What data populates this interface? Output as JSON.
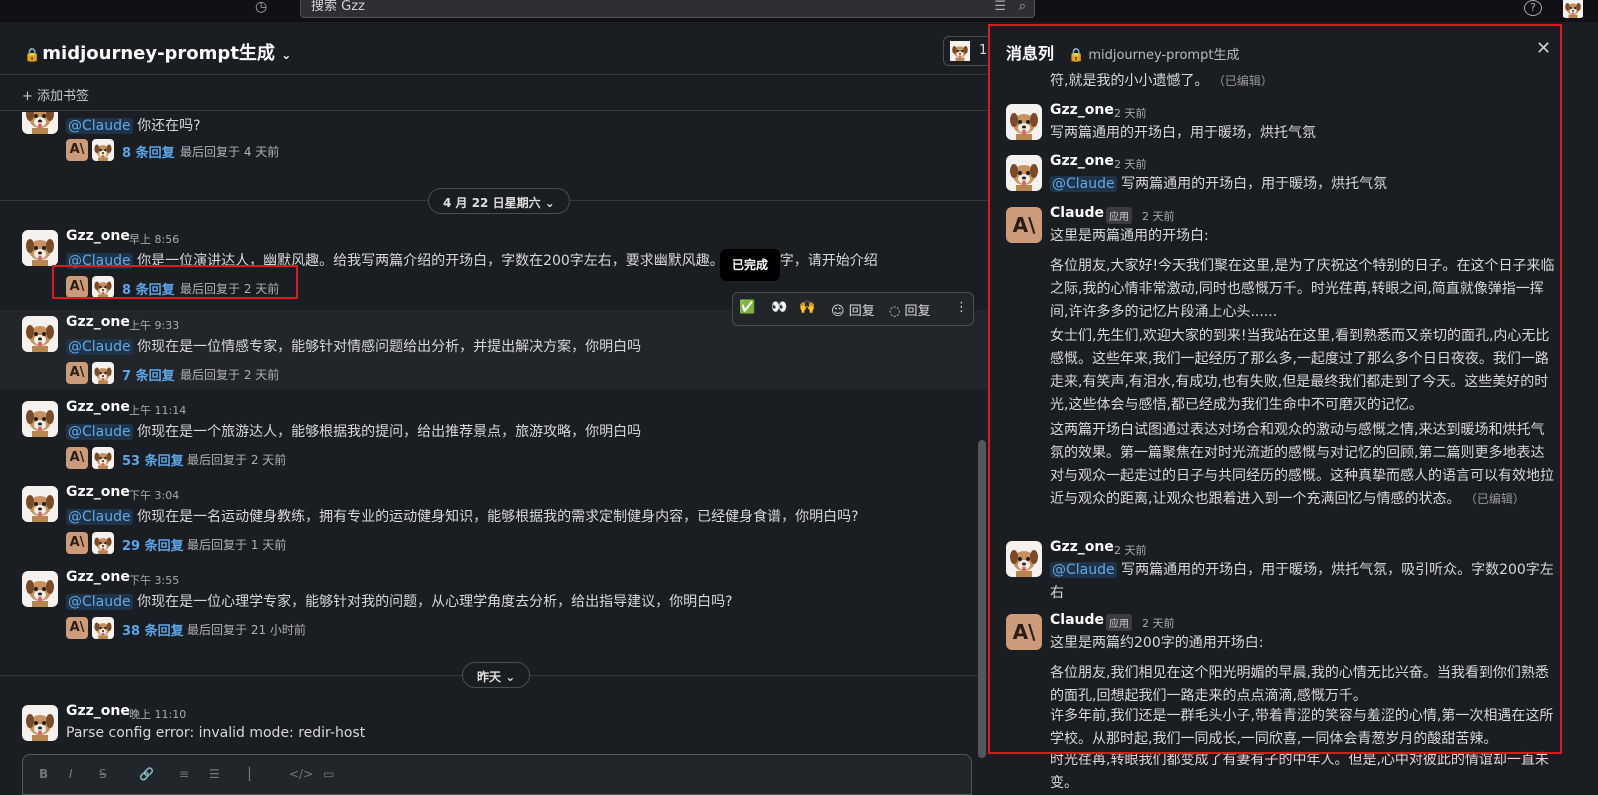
{
  "topbar": {
    "search_placeholder": "搜索 Gzz"
  },
  "channel": {
    "name": "midjourney-prompt生成",
    "member_count": "1",
    "add_bookmark": "添加书签"
  },
  "messages_top": {
    "text": "你还在吗?",
    "mention": "@Claude",
    "reply_count": "8 条回复",
    "last_reply": "最后回复于 4 天前"
  },
  "date_pill_1": "4 月 22 日星期六",
  "date_pill_2": "昨天",
  "messages": [
    {
      "name": "Gzz_one",
      "time": "早上 8:56",
      "mention": "@Claude",
      "text": "你是一位演讲达人，幽默风趣。给我写两篇介绍的开场白，字数在200字左右，要求幽默风趣。是你的名字，请开始介绍",
      "reply_count": "8 条回复",
      "last_reply": "最后回复于 2 天前"
    },
    {
      "name": "Gzz_one",
      "time": "上午 9:33",
      "mention": "@Claude",
      "text": "你现在是一位情感专家，能够针对情感问题给出分析，并提出解决方案，你明白吗",
      "reply_count": "7 条回复",
      "last_reply": "最后回复于 2 天前"
    },
    {
      "name": "Gzz_one",
      "time": "上午 11:14",
      "mention": "@Claude",
      "text": "你现在是一个旅游达人，能够根据我的提问，给出推荐景点，旅游攻略，你明白吗",
      "reply_count": "53 条回复",
      "last_reply": "最后回复于 2 天前"
    },
    {
      "name": "Gzz_one",
      "time": "下午 3:04",
      "mention": "@Claude",
      "text": "你现在是一名运动健身教练，拥有专业的运动健身知识，能够根据我的需求定制健身内容，已经健身食谱，你明白吗?",
      "reply_count": "29 条回复",
      "last_reply": "最后回复于 1 天前"
    },
    {
      "name": "Gzz_one",
      "time": "下午 3:55",
      "mention": "@Claude",
      "text": "你现在是一位心理学专家，能够针对我的问题，从心理学角度去分析，给出指导建议，你明白吗?",
      "reply_count": "38 条回复",
      "last_reply": "最后回复于 21 小时前"
    }
  ],
  "last_message": {
    "name": "Gzz_one",
    "time": "晚上 11:10",
    "text": "Parse config error: invalid mode: redir-host"
  },
  "toolbar": {
    "tooltip": "已完成",
    "check": "✅",
    "eyes": "👀",
    "hands": "🙌",
    "reply_emoji": "回复",
    "reply": "回复"
  },
  "thread": {
    "title": "消息列",
    "channel": "midjourney-prompt生成",
    "top_fragment": "符,就是我的小小遗憾了。",
    "edited": "（已编辑）",
    "app_tag": "应用",
    "m1": {
      "name": "Gzz_one",
      "time": "2 天前",
      "text": "写两篇通用的开场白，用于暖场，烘托气氛"
    },
    "m2": {
      "name": "Gzz_one",
      "time": "2 天前",
      "mention": "@Claude",
      "text": "写两篇通用的开场白，用于暖场，烘托气氛"
    },
    "m3": {
      "name": "Claude",
      "time": "2 天前",
      "text": "这里是两篇通用的开场白:",
      "p1": "各位朋友,大家好!今天我们聚在这里,是为了庆祝这个特别的日子。在这个日子来临之际,我的心情非常激动,同时也感慨万千。时光荏苒,转眼之间,简直就像弹指一挥间,许许多多的记忆片段涌上心头......",
      "p2": "女士们,先生们,欢迎大家的到来!当我站在这里,看到熟悉而又亲切的面孔,内心无比感慨。这些年来,我们一起经历了那么多,一起度过了那么多个日日夜夜。我们一路走来,有笑声,有泪水,有成功,也有失败,但是最终我们都走到了今天。这些美好的时光,这些体会与感悟,都已经成为我们生命中不可磨灭的记忆。",
      "p3": "这两篇开场白试图通过表达对场合和观众的激动与感慨之情,来达到暖场和烘托气氛的效果。第一篇聚焦在对时光流逝的感慨与对记忆的回顾,第二篇则更多地表达对与观众一起走过的日子与共同经历的感慨。这种真挚而感人的语言可以有效地拉近与观众的距离,让观众也跟着进入到一个充满回忆与情感的状态。"
    },
    "m4": {
      "name": "Gzz_one",
      "time": "2 天前",
      "mention": "@Claude",
      "text": "写两篇通用的开场白，用于暖场，烘托气氛，吸引听众。字数200字左右"
    },
    "m5": {
      "name": "Claude",
      "time": "2 天前",
      "text": "这里是两篇约200字的通用开场白:",
      "p1": "各位朋友,我们相见在这个阳光明媚的早晨,我的心情无比兴奋。当我看到你们熟悉的面孔,回想起我们一路走来的点点滴滴,感慨万千。",
      "p2": "许多年前,我们还是一群毛头小子,带着青涩的笑容与羞涩的心情,第一次相遇在这所学校。从那时起,我们一同成长,一同欣喜,一同体会青葱岁月的酸甜苦辣。",
      "p3": "时光荏苒,转眼我们都变成了有妻有子的中年人。但是,心中对彼此的情谊却一直未变。"
    }
  },
  "colors": {
    "accent": "#5ba5e8",
    "highlight": "#e0191f",
    "claude": "#cc9b7a"
  }
}
